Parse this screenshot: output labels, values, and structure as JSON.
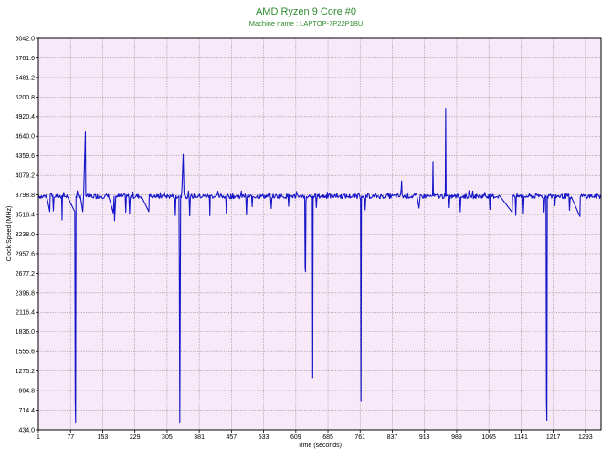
{
  "chart_data": {
    "type": "line",
    "title": "AMD Ryzen 9 Core #0",
    "subtitle": "Machine name : LAPTOP-7P22P1BU",
    "xlabel": "Time (seconds)",
    "ylabel": "Clock Speed (MHz)",
    "xlim": [
      1,
      1330
    ],
    "ylim": [
      434.0,
      6042.0
    ],
    "x_ticks": [
      "1",
      "77",
      "153",
      "229",
      "305",
      "381",
      "457",
      "533",
      "609",
      "685",
      "761",
      "837",
      "913",
      "989",
      "1065",
      "1141",
      "1217",
      "1293"
    ],
    "y_ticks": [
      "6042.0",
      "5761.6",
      "5481.2",
      "5200.8",
      "4920.4",
      "4640.0",
      "4359.6",
      "4079.2",
      "3798.8",
      "3518.4",
      "3238.0",
      "2957.6",
      "2677.2",
      "2396.8",
      "2116.4",
      "1836.0",
      "1555.6",
      "1275.2",
      "994.8",
      "714.4",
      "434.0"
    ],
    "grid": true,
    "background": "#f7e9f7",
    "line_color": "#1414c8",
    "baseline": 3780,
    "series": [
      {
        "name": "",
        "points": [
          [
            1,
            3790
          ],
          [
            10,
            3760
          ],
          [
            20,
            3800
          ],
          [
            28,
            3560
          ],
          [
            29,
            3800
          ],
          [
            40,
            3770
          ],
          [
            56,
            3780
          ],
          [
            57,
            3440
          ],
          [
            58,
            3790
          ],
          [
            70,
            3770
          ],
          [
            87,
            3560
          ],
          [
            88,
            870
          ],
          [
            89,
            530
          ],
          [
            90,
            3780
          ],
          [
            100,
            3790
          ],
          [
            106,
            3560
          ],
          [
            108,
            3800
          ],
          [
            112,
            4700
          ],
          [
            113,
            3790
          ],
          [
            130,
            3760
          ],
          [
            150,
            3780
          ],
          [
            170,
            3720
          ],
          [
            178,
            3540
          ],
          [
            180,
            3780
          ],
          [
            181,
            3430
          ],
          [
            184,
            3780
          ],
          [
            200,
            3780
          ],
          [
            220,
            3790
          ],
          [
            245,
            3770
          ],
          [
            262,
            3560
          ],
          [
            263,
            3800
          ],
          [
            280,
            3770
          ],
          [
            300,
            3790
          ],
          [
            320,
            3760
          ],
          [
            333,
            3780
          ],
          [
            334,
            2630
          ],
          [
            335,
            530
          ],
          [
            337,
            3790
          ],
          [
            340,
            3880
          ],
          [
            343,
            4380
          ],
          [
            345,
            3820
          ],
          [
            360,
            3760
          ],
          [
            380,
            3780
          ],
          [
            405,
            3790
          ],
          [
            406,
            3500
          ],
          [
            407,
            3780
          ],
          [
            430,
            3770
          ],
          [
            470,
            3790
          ],
          [
            500,
            3770
          ],
          [
            530,
            3790
          ],
          [
            560,
            3780
          ],
          [
            580,
            3770
          ],
          [
            600,
            3790
          ],
          [
            620,
            3780
          ],
          [
            630,
            3780
          ],
          [
            631,
            2760
          ],
          [
            632,
            2700
          ],
          [
            633,
            3700
          ],
          [
            640,
            3780
          ],
          [
            648,
            3780
          ],
          [
            649,
            1180
          ],
          [
            650,
            3780
          ],
          [
            670,
            3770
          ],
          [
            700,
            3790
          ],
          [
            730,
            3770
          ],
          [
            760,
            3780
          ],
          [
            762,
            3720
          ],
          [
            763,
            850
          ],
          [
            764,
            3780
          ],
          [
            790,
            3780
          ],
          [
            820,
            3770
          ],
          [
            840,
            3790
          ],
          [
            858,
            3880
          ],
          [
            859,
            4000
          ],
          [
            860,
            3810
          ],
          [
            880,
            3770
          ],
          [
            895,
            3790
          ],
          [
            900,
            3610
          ],
          [
            903,
            3800
          ],
          [
            920,
            3780
          ],
          [
            932,
            3790
          ],
          [
            933,
            4280
          ],
          [
            934,
            3790
          ],
          [
            950,
            3770
          ],
          [
            962,
            3780
          ],
          [
            963,
            5040
          ],
          [
            964,
            3780
          ],
          [
            975,
            3790
          ],
          [
            1000,
            3770
          ],
          [
            1030,
            3780
          ],
          [
            1060,
            3760
          ],
          [
            1090,
            3790
          ],
          [
            1120,
            3550
          ],
          [
            1121,
            3780
          ],
          [
            1150,
            3770
          ],
          [
            1180,
            3790
          ],
          [
            1185,
            3800
          ],
          [
            1200,
            3780
          ],
          [
            1201,
            850
          ],
          [
            1202,
            570
          ],
          [
            1203,
            3780
          ],
          [
            1230,
            3790
          ],
          [
            1245,
            3830
          ],
          [
            1260,
            3770
          ],
          [
            1280,
            3490
          ],
          [
            1281,
            3780
          ],
          [
            1300,
            3790
          ],
          [
            1330,
            3780
          ]
        ]
      }
    ]
  }
}
